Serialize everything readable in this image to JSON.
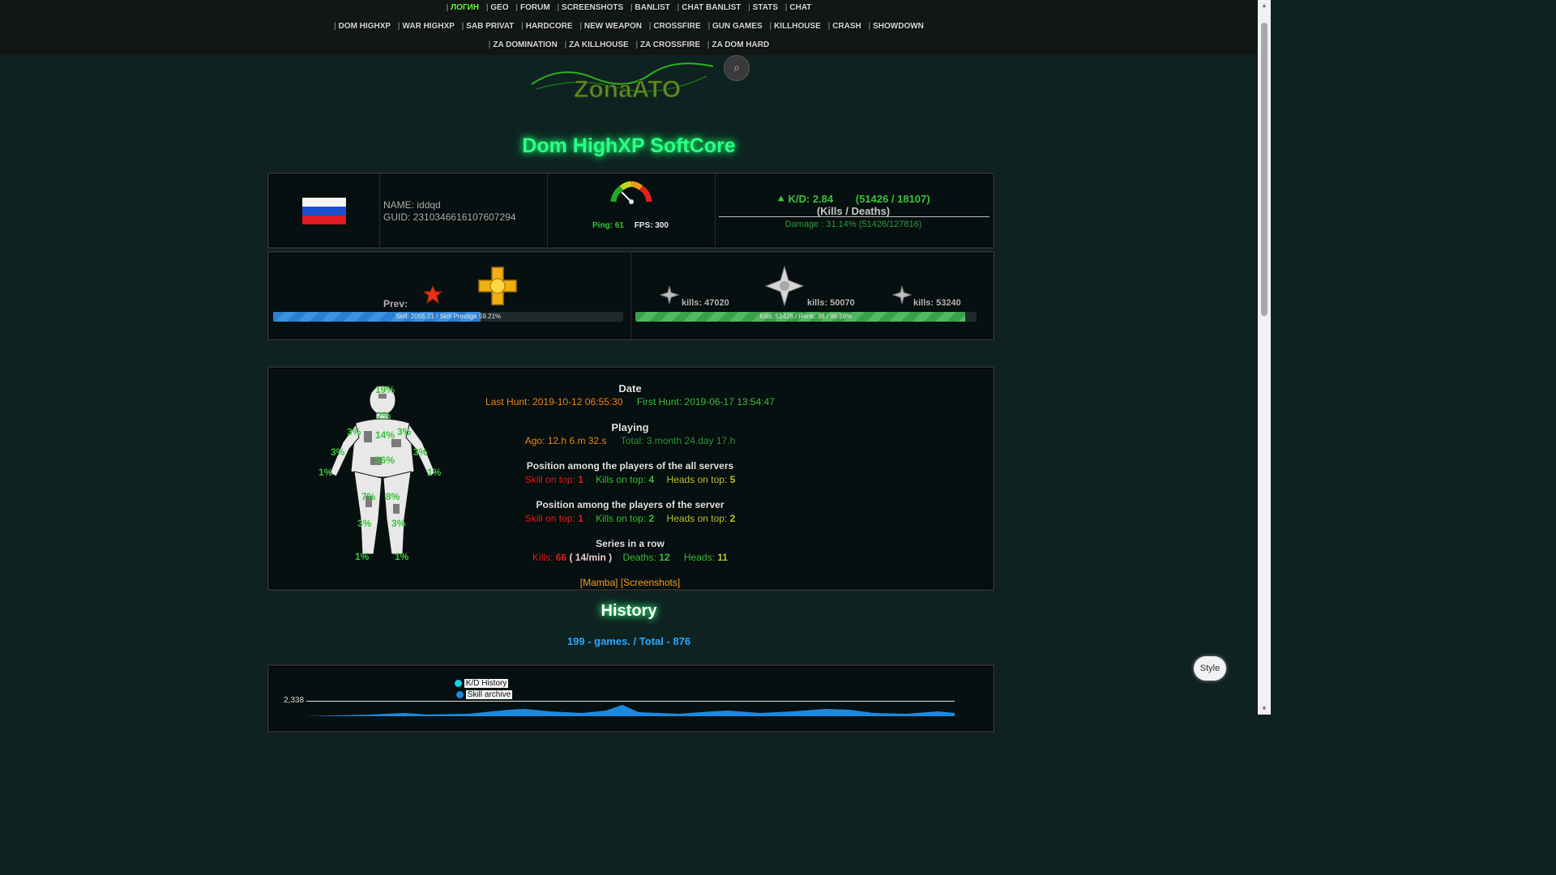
{
  "nav": {
    "row1": [
      "ЛОГИН",
      "GEO",
      "FORUM",
      "SCREENSHOTS",
      "BANLIST",
      "CHAT BANLIST",
      "STATS",
      "CHAT"
    ],
    "row2": [
      "DOM HIGHXP",
      "WAR HIGHXP",
      "SAB PRIVAT",
      "HARDCORE",
      "NEW WEAPON",
      "CROSSFIRE",
      "GUN GAMES",
      "KILLHOUSE",
      "CRASH",
      "SHOWDOWN"
    ],
    "row3": [
      "ZA DOMINATION",
      "ZA KILLHOUSE",
      "ZA CROSSFIRE",
      "ZA DOM HARD"
    ]
  },
  "logo_text": "ZonaATO",
  "page_title": "Dom HighXP SoftCore",
  "player": {
    "name_label": "NAME:",
    "name": "iddqd",
    "guid_label": "GUID:",
    "guid": "2310346616107607294",
    "ping_label": "Ping:",
    "ping": "61",
    "fps_label": "FPS:",
    "fps": "300",
    "kd_label": "K/D:",
    "kd": "2.84",
    "kd_ratio": "(51426 / 18107)",
    "kd_caption": "(Kills / Deaths)",
    "damage": "Damage : 31.14% (51426/127816)"
  },
  "skill": {
    "prev_label": "Prev:",
    "bar_text": "Skill: 2055.21 / Skill Prestige 59.21%",
    "progress": 0.5921
  },
  "rank": {
    "kills_prev": "kills: 47020",
    "kills_cur": "kills: 50070",
    "kills_next": "kills: 53240",
    "bar_text": "Kills: 51426 / Rank: 38 / 96.59%",
    "progress": 0.9659
  },
  "hits": {
    "head": "19%",
    "neck": "2%",
    "l_shoulder": "3%",
    "r_shoulder": "3%",
    "chest": "14%",
    "l_upper_arm": "3%",
    "r_upper_arm": "3%",
    "stomach": "36%",
    "l_hand": "1%",
    "r_hand": "1%",
    "l_thigh": "7%",
    "r_thigh": "8%",
    "l_calf": "3%",
    "r_calf": "3%",
    "l_foot": "1%",
    "r_foot": "1%"
  },
  "stats": {
    "date_title": "Date",
    "last_hunt": "Last Hunt: 2019-10-12 06:55:30",
    "first_hunt": "First Hunt: 2019-06-17 13:54:47",
    "playing_title": "Playing",
    "ago": "Ago: 12.h 6.m 32.s",
    "total": "Total: 3.month 24.day 17.h",
    "pos_all_title": "Position among the players of the all servers",
    "pos_all": {
      "skill_label": "Skill on top:",
      "skill": "1",
      "kills_label": "Kills on top:",
      "kills": "4",
      "heads_label": "Heads on top:",
      "heads": "5"
    },
    "pos_srv_title": "Position among the players of the server",
    "pos_srv": {
      "skill_label": "Skill on top:",
      "skill": "1",
      "kills_label": "Kills on top:",
      "kills": "2",
      "heads_label": "Heads on top:",
      "heads": "2"
    },
    "series_title": "Series in a row",
    "series": {
      "kills_label": "Kills:",
      "kills": "66",
      "kpm": "( 14/min )",
      "deaths_label": "Deaths:",
      "deaths": "12",
      "heads_label": "Heads:",
      "heads": "11"
    },
    "links": "[Mamba] [Screenshots]"
  },
  "history": {
    "title": "History",
    "subtitle": "199 - games. / Total - 876",
    "legend": [
      "K/D History",
      "Skill archive"
    ],
    "y_tick": "2,338"
  },
  "style_button": "Style",
  "colors": {
    "bg": "#0f2222",
    "accent_green": "#2cff8a",
    "link_blue": "#2aa8ff",
    "skill_bar": "#2a7fd0",
    "rank_bar": "#3aa04a"
  }
}
